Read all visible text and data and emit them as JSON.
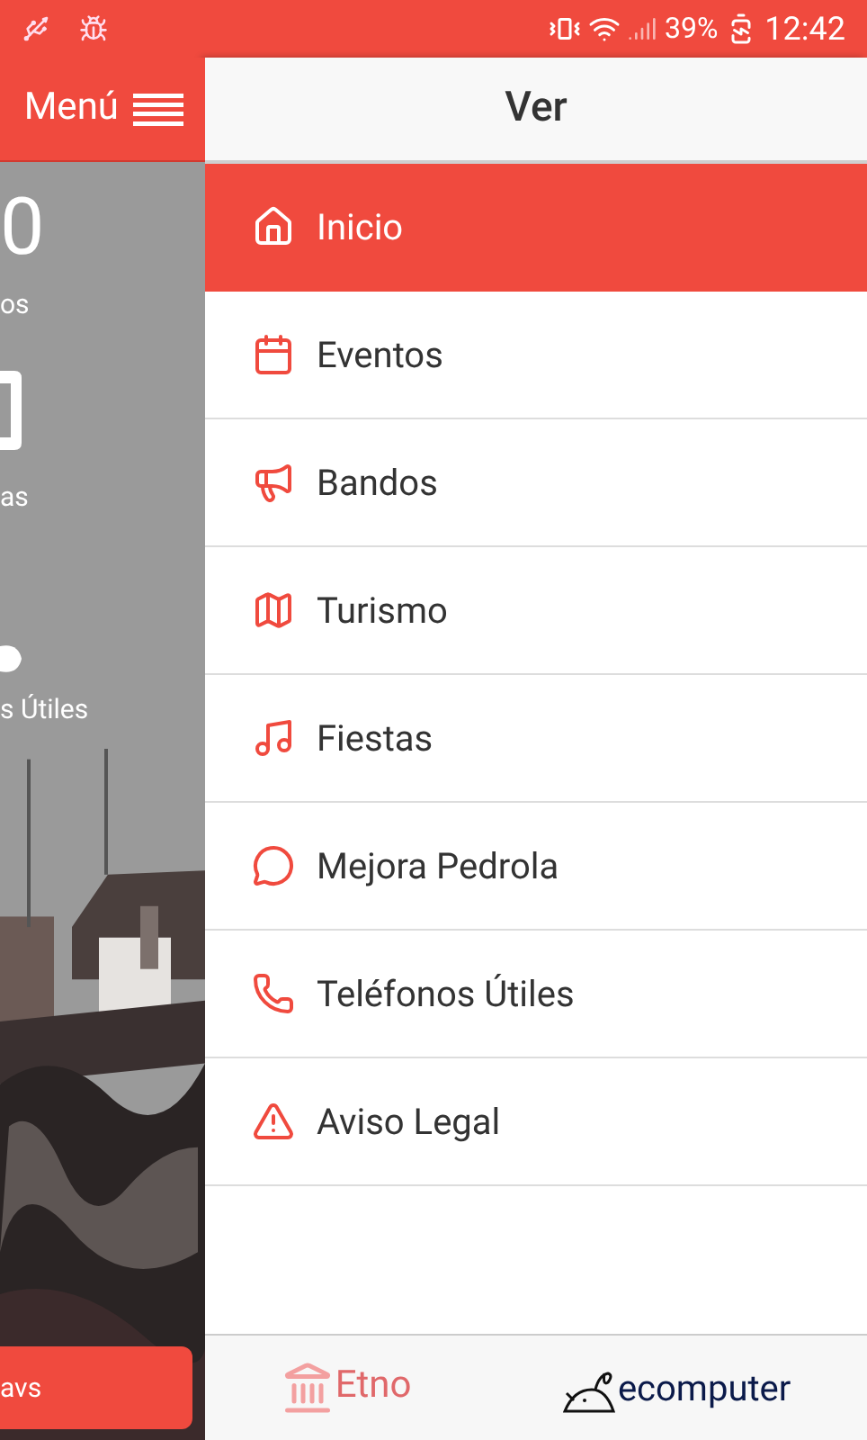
{
  "status_bar": {
    "battery": "39%",
    "time": "12:42"
  },
  "background_screen": {
    "menu_label": "Menú",
    "number": "0",
    "labels": [
      "os",
      "as",
      "s Útiles"
    ],
    "button": "avs"
  },
  "panel": {
    "title": "Ver"
  },
  "items": [
    {
      "label": "Inicio",
      "selected": true
    },
    {
      "label": "Eventos",
      "selected": false
    },
    {
      "label": "Bandos",
      "selected": false
    },
    {
      "label": "Turismo",
      "selected": false
    },
    {
      "label": "Fiestas",
      "selected": false
    },
    {
      "label": "Mejora Pedrola",
      "selected": false
    },
    {
      "label": "Teléfonos Útiles",
      "selected": false
    },
    {
      "label": "Aviso Legal",
      "selected": false
    }
  ],
  "footer": {
    "logos": [
      "Etno",
      "ecomputer"
    ]
  }
}
